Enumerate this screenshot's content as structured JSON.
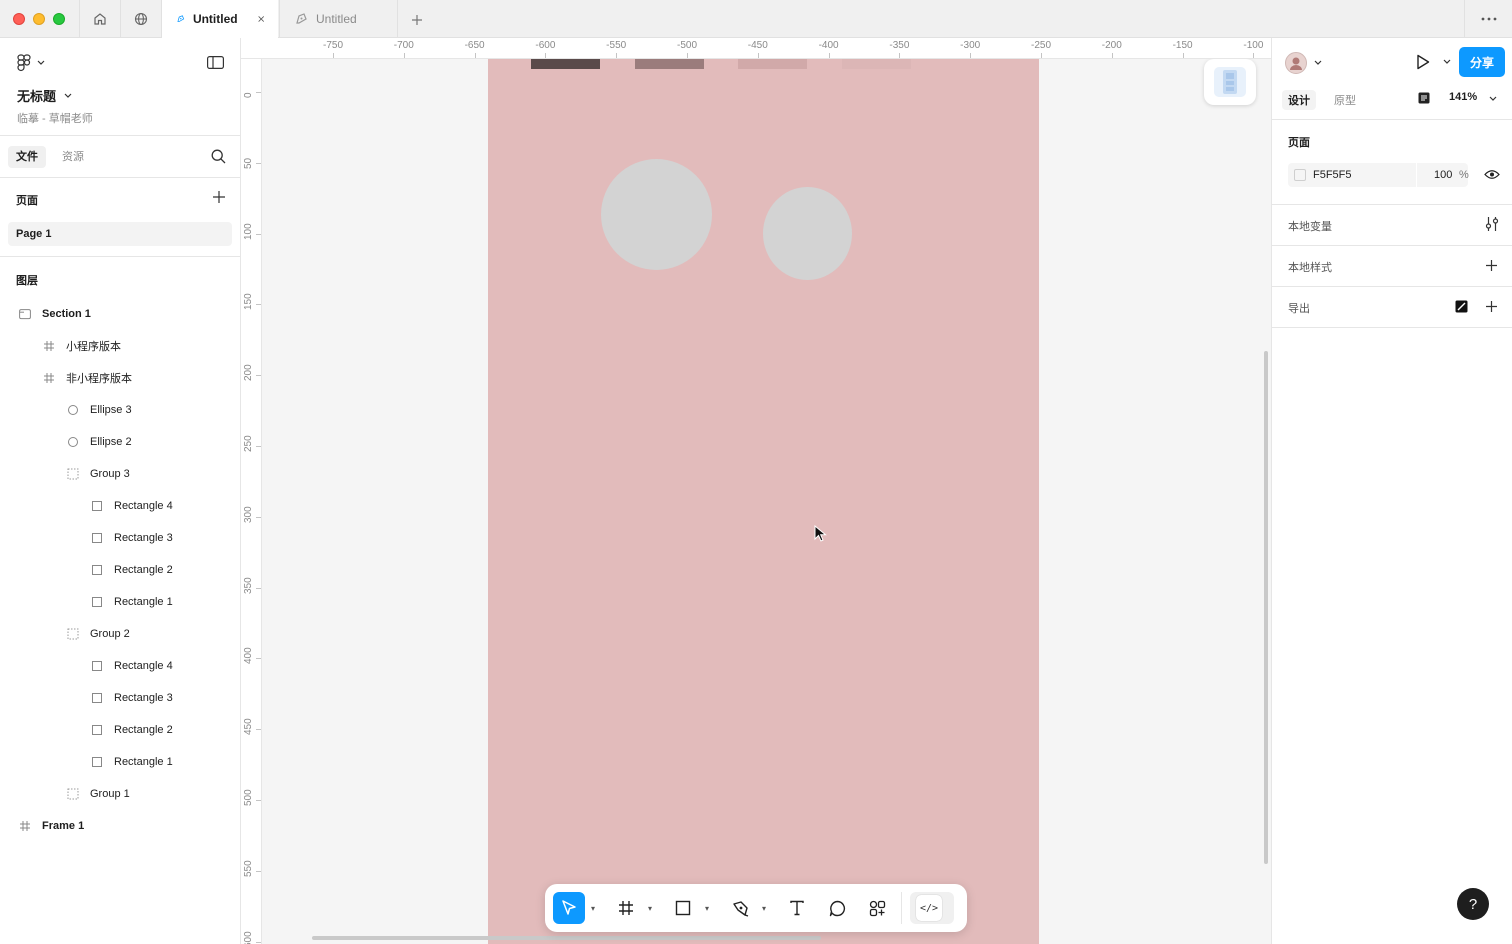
{
  "titlebar": {
    "tabs": [
      {
        "label": "Untitled",
        "active": true
      },
      {
        "label": "Untitled",
        "active": false
      }
    ]
  },
  "left_panel": {
    "file_title": "无标题",
    "file_subtitle": "临摹 - 草帽老师",
    "tabs": {
      "files": "文件",
      "assets": "资源"
    },
    "pages_header": "页面",
    "pages": [
      "Page 1"
    ],
    "layers_header": "图层",
    "layers": [
      {
        "label": "Section 1",
        "icon": "section-icon",
        "depth": 0,
        "bold": true
      },
      {
        "label": "小程序版本",
        "icon": "frame-icon",
        "depth": 1,
        "bold": false
      },
      {
        "label": "非小程序版本",
        "icon": "frame-icon",
        "depth": 1,
        "bold": false
      },
      {
        "label": "Ellipse 3",
        "icon": "ellipse-icon",
        "depth": 2,
        "bold": false
      },
      {
        "label": "Ellipse 2",
        "icon": "ellipse-icon",
        "depth": 2,
        "bold": false
      },
      {
        "label": "Group 3",
        "icon": "group-icon",
        "depth": 2,
        "bold": false
      },
      {
        "label": "Rectangle 4",
        "icon": "rectangle-icon",
        "depth": 3,
        "bold": false
      },
      {
        "label": "Rectangle 3",
        "icon": "rectangle-icon",
        "depth": 3,
        "bold": false
      },
      {
        "label": "Rectangle 2",
        "icon": "rectangle-icon",
        "depth": 3,
        "bold": false
      },
      {
        "label": "Rectangle 1",
        "icon": "rectangle-icon",
        "depth": 3,
        "bold": false
      },
      {
        "label": "Group 2",
        "icon": "group-icon",
        "depth": 2,
        "bold": false
      },
      {
        "label": "Rectangle 4",
        "icon": "rectangle-icon",
        "depth": 3,
        "bold": false
      },
      {
        "label": "Rectangle 3",
        "icon": "rectangle-icon",
        "depth": 3,
        "bold": false
      },
      {
        "label": "Rectangle 2",
        "icon": "rectangle-icon",
        "depth": 3,
        "bold": false
      },
      {
        "label": "Rectangle 1",
        "icon": "rectangle-icon",
        "depth": 3,
        "bold": false
      },
      {
        "label": "Group 1",
        "icon": "group-icon",
        "depth": 2,
        "bold": false
      },
      {
        "label": "Frame 1",
        "icon": "frame-icon",
        "depth": 0,
        "bold": true
      }
    ]
  },
  "rulers": {
    "top": [
      "-750",
      "-700",
      "-650",
      "-600",
      "-550",
      "-500",
      "-450",
      "-400",
      "-350",
      "-300",
      "-250",
      "-200",
      "-150",
      "-100"
    ],
    "left": [
      "0",
      "50",
      "100",
      "150",
      "200",
      "250",
      "300",
      "350",
      "400",
      "450",
      "500",
      "550",
      "600"
    ]
  },
  "canvas": {
    "frame_color": "#e2bbbb",
    "rect_colors": [
      "#5a4a4a",
      "#9b7c7c",
      "#d1a9a9",
      "#dcb6b6"
    ],
    "circle_color": "#d3d3d3"
  },
  "toolbar": {
    "tools": [
      "move-tool",
      "frame-tool",
      "rectangle-tool",
      "pen-tool",
      "text-tool",
      "comment-tool",
      "actions-tool"
    ],
    "code_label": "</>"
  },
  "right_panel": {
    "share_label": "分享",
    "tabs": {
      "design": "设计",
      "prototype": "原型"
    },
    "zoom": "141%",
    "page_section_title": "页面",
    "page_fill_hex": "F5F5F5",
    "page_fill_opacity": "100",
    "page_fill_opacity_unit": "%",
    "local_variables": "本地变量",
    "local_styles": "本地样式",
    "export": "导出",
    "help_label": "?"
  },
  "colors": {
    "accent": "#0d99ff"
  }
}
